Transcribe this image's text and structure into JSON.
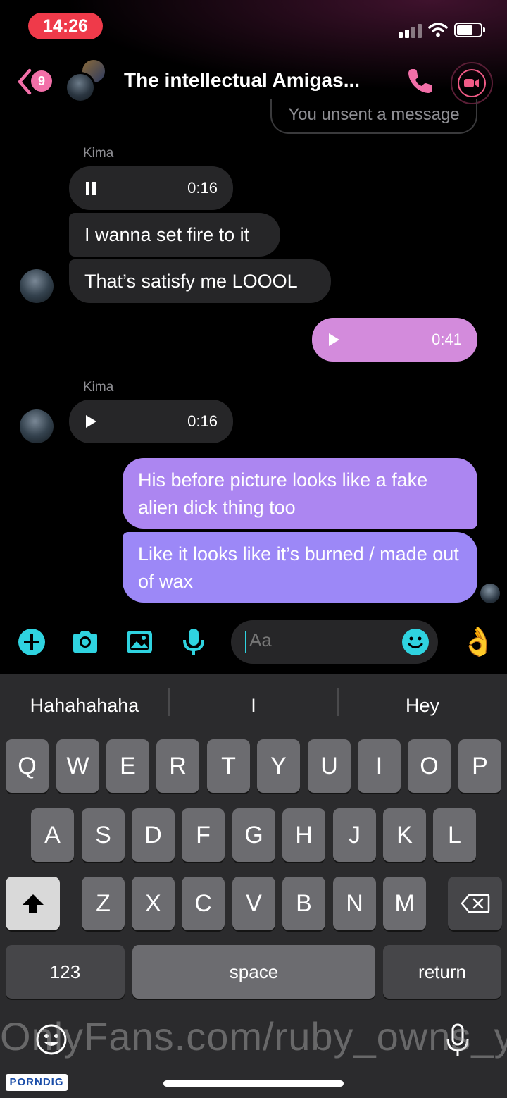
{
  "status_bar": {
    "time": "14:26",
    "icons": [
      "signal-icon",
      "wifi-icon",
      "battery-icon"
    ]
  },
  "header": {
    "back_badge": "9",
    "title": "The intellectual Amigas...",
    "icons": [
      "back-chevron-icon",
      "phone-icon",
      "video-camera-icon"
    ],
    "accent": "#f26fa8"
  },
  "messages": {
    "unsent_notice": "You unsent a message",
    "group1": {
      "sender": "Kima",
      "voice_duration": "0:16",
      "text1": "I wanna set fire to it",
      "text2": "That’s satisfy me LOOOL"
    },
    "outgoing_voice_duration": "0:41",
    "group2": {
      "sender": "Kima",
      "voice_duration": "0:16"
    },
    "outgoing_text1": "His before picture looks like a fake alien dick thing too",
    "outgoing_text2": "Like it looks like it’s burned / made out of wax"
  },
  "composer": {
    "placeholder": "Aa",
    "tools": [
      "plus-icon",
      "camera-icon",
      "gallery-icon",
      "microphone-icon"
    ],
    "quick_reaction": "👌",
    "accent": "#2fd3e0"
  },
  "keyboard": {
    "suggestions": [
      "Hahahahaha",
      "I",
      "Hey"
    ],
    "row1": [
      "Q",
      "W",
      "E",
      "R",
      "T",
      "Y",
      "U",
      "I",
      "O",
      "P"
    ],
    "row2": [
      "A",
      "S",
      "D",
      "F",
      "G",
      "H",
      "J",
      "K",
      "L"
    ],
    "row3": [
      "Z",
      "X",
      "C",
      "V",
      "B",
      "N",
      "M"
    ],
    "numbers": "123",
    "space": "space",
    "return": "return"
  },
  "overlay": {
    "watermark": "OnlyFans.com/ruby_owns_y",
    "logo": "PORNDIG"
  }
}
